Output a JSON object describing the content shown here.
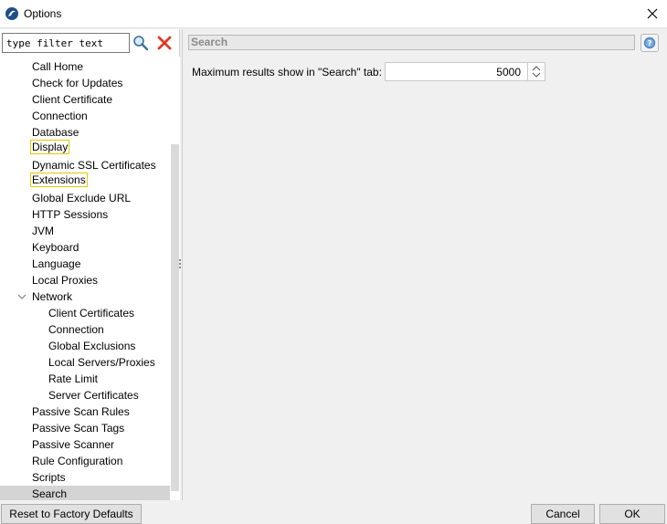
{
  "window": {
    "title": "Options"
  },
  "filter": {
    "placeholder": "type filter text"
  },
  "tree": {
    "items": [
      {
        "label": "Call Home"
      },
      {
        "label": "Check for Updates"
      },
      {
        "label": "Client Certificate"
      },
      {
        "label": "Connection"
      },
      {
        "label": "Database"
      },
      {
        "label": "Display",
        "highlighted": true
      },
      {
        "label": "Dynamic SSL Certificates"
      },
      {
        "label": "Extensions",
        "highlighted": true
      },
      {
        "label": "Global Exclude URL"
      },
      {
        "label": "HTTP Sessions"
      },
      {
        "label": "JVM"
      },
      {
        "label": "Keyboard"
      },
      {
        "label": "Language"
      },
      {
        "label": "Local Proxies"
      },
      {
        "label": "Network",
        "expanded": true
      },
      {
        "label": "Client Certificates"
      },
      {
        "label": "Connection"
      },
      {
        "label": "Global Exclusions"
      },
      {
        "label": "Local Servers/Proxies"
      },
      {
        "label": "Rate Limit"
      },
      {
        "label": "Server Certificates"
      },
      {
        "label": "Passive Scan Rules"
      },
      {
        "label": "Passive Scan Tags"
      },
      {
        "label": "Passive Scanner"
      },
      {
        "label": "Rule Configuration"
      },
      {
        "label": "Scripts"
      },
      {
        "label": "Search",
        "selected": true
      }
    ]
  },
  "panel": {
    "title": "Search",
    "max_results_label": "Maximum results show in \"Search\" tab:",
    "max_results_value": "5000"
  },
  "buttons": {
    "reset": "Reset to Factory Defaults",
    "cancel": "Cancel",
    "ok": "OK"
  },
  "colors": {
    "highlight_border": "#e6c800",
    "selected_row": "#d4d4d4",
    "clear_icon": "#e03b24",
    "help_icon": "#4a86c8"
  }
}
